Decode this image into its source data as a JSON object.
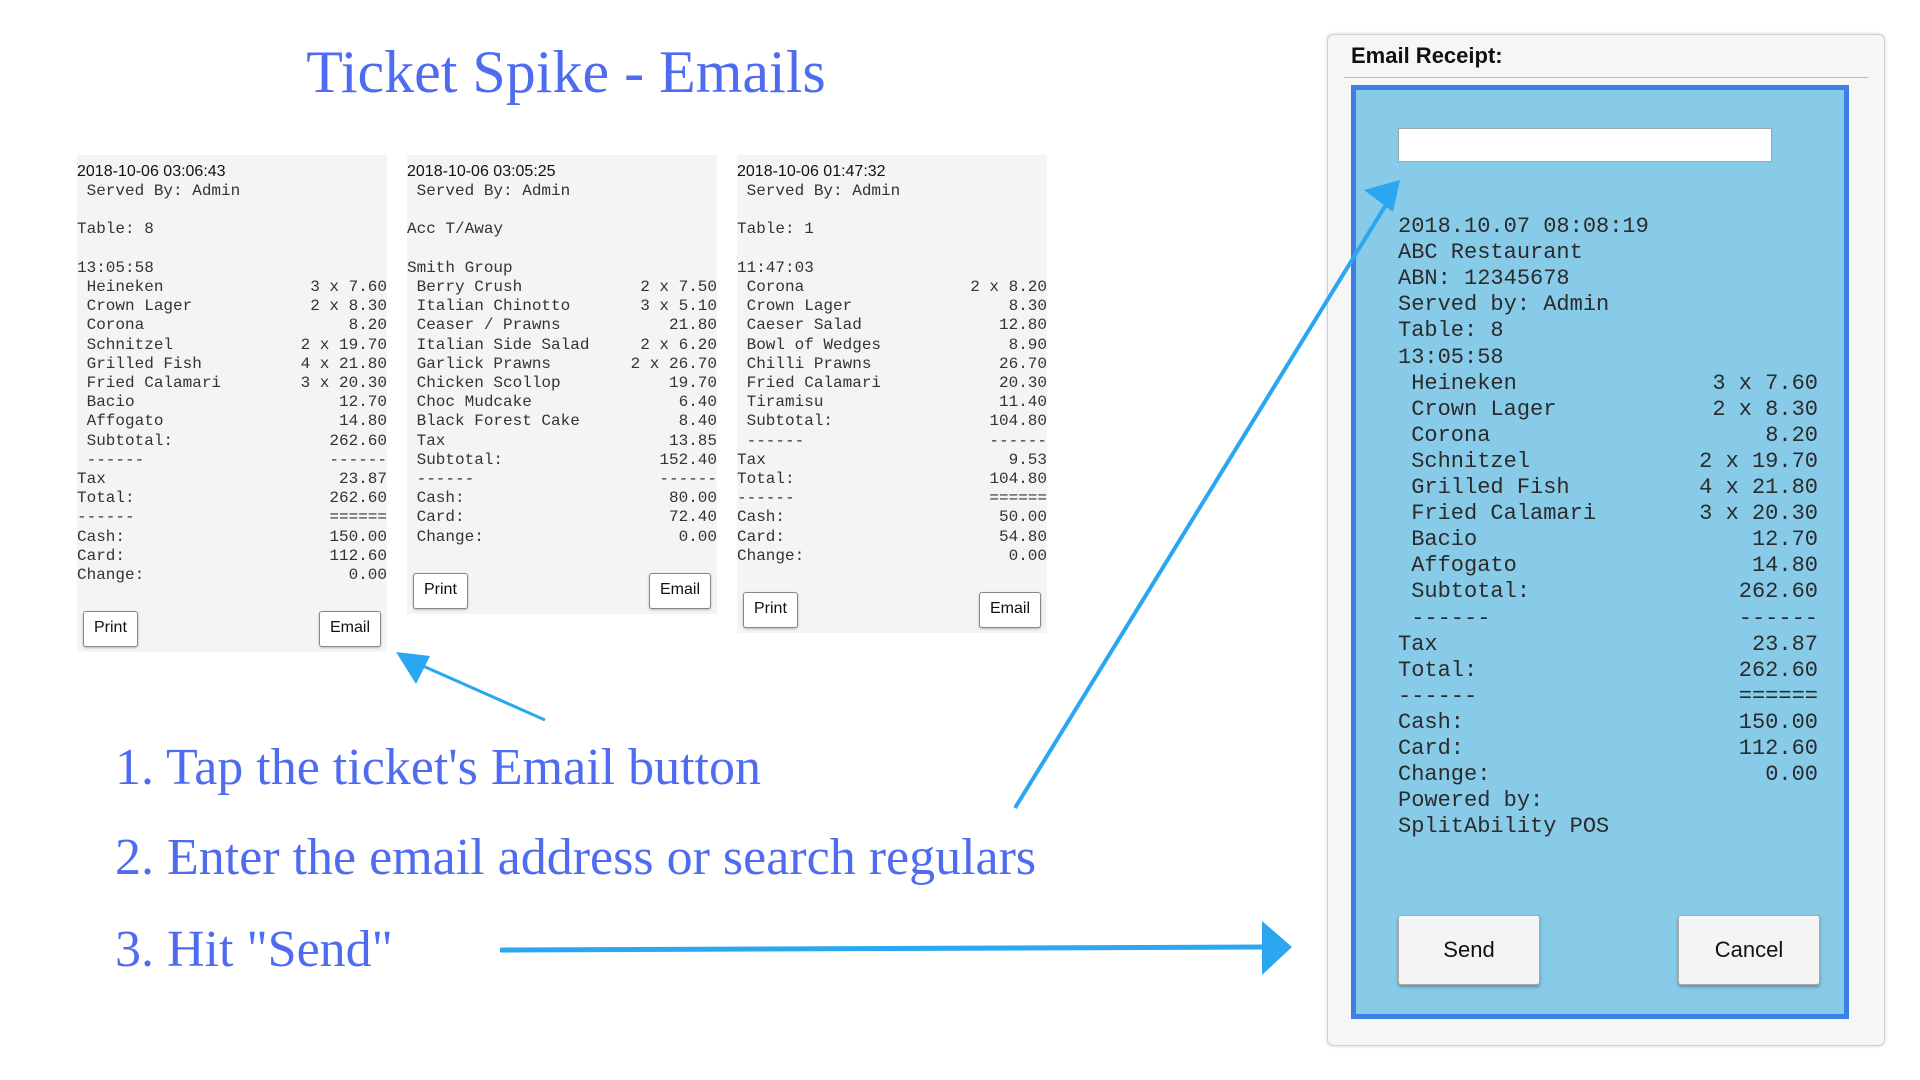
{
  "title": "Ticket Spike - Emails",
  "tickets": [
    {
      "timestamp": "2018-10-06 03:06:43",
      "lines": [
        {
          "l": " Served By: Admin",
          "r": ""
        },
        {
          "l": "",
          "r": ""
        },
        {
          "l": "Table: 8",
          "r": ""
        },
        {
          "l": "",
          "r": ""
        },
        {
          "l": "13:05:58",
          "r": ""
        },
        {
          "l": " Heineken",
          "r": "3 x 7.60"
        },
        {
          "l": " Crown Lager",
          "r": "2 x 8.30"
        },
        {
          "l": " Corona",
          "r": "8.20"
        },
        {
          "l": " Schnitzel",
          "r": "2 x 19.70"
        },
        {
          "l": " Grilled Fish",
          "r": "4 x 21.80"
        },
        {
          "l": " Fried Calamari",
          "r": "3 x 20.30"
        },
        {
          "l": " Bacio",
          "r": "12.70"
        },
        {
          "l": " Affogato",
          "r": "14.80"
        },
        {
          "l": " Subtotal:",
          "r": "262.60"
        },
        {
          "l": " ------",
          "r": "------"
        },
        {
          "l": "Tax",
          "r": "23.87"
        },
        {
          "l": "Total:",
          "r": "262.60"
        },
        {
          "l": "------",
          "r": "======"
        },
        {
          "l": "Cash:",
          "r": "150.00"
        },
        {
          "l": "Card:",
          "r": "112.60"
        },
        {
          "l": "Change:",
          "r": "0.00"
        }
      ],
      "print_label": "Print",
      "email_label": "Email"
    },
    {
      "timestamp": "2018-10-06 03:05:25",
      "lines": [
        {
          "l": " Served By: Admin",
          "r": ""
        },
        {
          "l": "",
          "r": ""
        },
        {
          "l": "Acc T/Away",
          "r": ""
        },
        {
          "l": "",
          "r": ""
        },
        {
          "l": "Smith Group",
          "r": ""
        },
        {
          "l": " Berry Crush",
          "r": "2 x 7.50"
        },
        {
          "l": " Italian Chinotto",
          "r": "3 x 5.10"
        },
        {
          "l": " Ceaser / Prawns",
          "r": "21.80"
        },
        {
          "l": " Italian Side Salad",
          "r": "2 x 6.20"
        },
        {
          "l": " Garlick Prawns",
          "r": "2 x 26.70"
        },
        {
          "l": " Chicken Scollop",
          "r": "19.70"
        },
        {
          "l": " Choc Mudcake",
          "r": "6.40"
        },
        {
          "l": " Black Forest Cake",
          "r": "8.40"
        },
        {
          "l": " Tax",
          "r": "13.85"
        },
        {
          "l": " Subtotal:",
          "r": "152.40"
        },
        {
          "l": " ------",
          "r": "------"
        },
        {
          "l": " Cash:",
          "r": "80.00"
        },
        {
          "l": " Card:",
          "r": "72.40"
        },
        {
          "l": " Change:",
          "r": "0.00"
        }
      ],
      "print_label": "Print",
      "email_label": "Email"
    },
    {
      "timestamp": "2018-10-06 01:47:32",
      "lines": [
        {
          "l": " Served By: Admin",
          "r": ""
        },
        {
          "l": "",
          "r": ""
        },
        {
          "l": "Table: 1",
          "r": ""
        },
        {
          "l": "",
          "r": ""
        },
        {
          "l": "11:47:03",
          "r": ""
        },
        {
          "l": " Corona",
          "r": "2 x 8.20"
        },
        {
          "l": " Crown Lager",
          "r": "8.30"
        },
        {
          "l": " Caeser Salad",
          "r": "12.80"
        },
        {
          "l": " Bowl of Wedges",
          "r": "8.90"
        },
        {
          "l": " Chilli Prawns",
          "r": "26.70"
        },
        {
          "l": " Fried Calamari",
          "r": "20.30"
        },
        {
          "l": " Tiramisu",
          "r": "11.40"
        },
        {
          "l": " Subtotal:",
          "r": "104.80"
        },
        {
          "l": " ------",
          "r": "------"
        },
        {
          "l": "Tax",
          "r": "9.53"
        },
        {
          "l": "Total:",
          "r": "104.80"
        },
        {
          "l": "------",
          "r": "======"
        },
        {
          "l": "Cash:",
          "r": "50.00"
        },
        {
          "l": "Card:",
          "r": "54.80"
        },
        {
          "l": "Change:",
          "r": "0.00"
        }
      ],
      "print_label": "Print",
      "email_label": "Email"
    }
  ],
  "steps": [
    "1. Tap the ticket's Email button",
    "2. Enter the email address or search regulars",
    "3. Hit \"Send\""
  ],
  "dialog": {
    "title": "Email Receipt:",
    "email_value": "",
    "receipt_lines": [
      {
        "l": "2018.10.07 08:08:19",
        "r": ""
      },
      {
        "l": "ABC Restaurant",
        "r": ""
      },
      {
        "l": "ABN: 12345678",
        "r": ""
      },
      {
        "l": "Served by: Admin",
        "r": ""
      },
      {
        "l": "Table: 8",
        "r": ""
      },
      {
        "l": "13:05:58",
        "r": ""
      },
      {
        "l": " Heineken",
        "r": "3 x 7.60"
      },
      {
        "l": " Crown Lager",
        "r": "2 x 8.30"
      },
      {
        "l": " Corona",
        "r": "8.20"
      },
      {
        "l": " Schnitzel",
        "r": "2 x 19.70"
      },
      {
        "l": " Grilled Fish",
        "r": "4 x 21.80"
      },
      {
        "l": " Fried Calamari",
        "r": "3 x 20.30"
      },
      {
        "l": " Bacio",
        "r": "12.70"
      },
      {
        "l": " Affogato",
        "r": "14.80"
      },
      {
        "l": " Subtotal:",
        "r": "262.60"
      },
      {
        "l": " ------",
        "r": "------"
      },
      {
        "l": "Tax",
        "r": "23.87"
      },
      {
        "l": "Total:",
        "r": "262.60"
      },
      {
        "l": "------",
        "r": "======"
      },
      {
        "l": "Cash:",
        "r": "150.00"
      },
      {
        "l": "Card:",
        "r": "112.60"
      },
      {
        "l": "Change:",
        "r": "0.00"
      },
      {
        "l": "Powered by:",
        "r": ""
      },
      {
        "l": "SplitAbility POS",
        "r": ""
      }
    ],
    "send_label": "Send",
    "cancel_label": "Cancel"
  },
  "colors": {
    "heading_blue": "#4f6cf0",
    "arrow_blue": "#2aa7f0",
    "receipt_bg": "#87cbe9",
    "receipt_border": "#3d7fe6",
    "ticket_bg": "#f4f4f4"
  }
}
